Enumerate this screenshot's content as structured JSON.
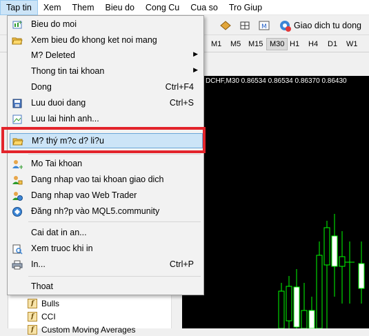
{
  "menubar": {
    "items": [
      "Tap tin",
      "Xem",
      "Them",
      "Bieu do",
      "Cong Cu",
      "Cua so",
      "Tro Giup"
    ]
  },
  "toolbar": {
    "trading_label": "Giao dich tu dong"
  },
  "timeframes": [
    "M1",
    "M5",
    "M15",
    "M30",
    "H1",
    "H4",
    "D1",
    "W1"
  ],
  "timeframe_active": "M30",
  "chart": {
    "header": "DCHF,M30  0.86534 0.86534 0.86370 0.86430"
  },
  "navigator": {
    "items": [
      "Bulls",
      "CCI",
      "Custom Moving Averages"
    ]
  },
  "file_menu": {
    "items": [
      {
        "label": "Bieu do moi",
        "shortcut": "",
        "icon": "new-chart-icon"
      },
      {
        "label": "Xem bieu đo khong ket noi mang",
        "shortcut": "",
        "icon": "open-folder-icon"
      },
      {
        "label": "M? Deleted",
        "shortcut": "",
        "icon": "",
        "submenu": true
      },
      {
        "label": "Thong tin tai khoan",
        "shortcut": "",
        "icon": "",
        "submenu": true
      },
      {
        "label": "Dong",
        "shortcut": "Ctrl+F4",
        "icon": ""
      },
      {
        "label": "Luu duoi dang",
        "shortcut": "Ctrl+S",
        "icon": "save-icon"
      },
      {
        "label": "Luu lai hinh anh...",
        "shortcut": "",
        "icon": "save-image-icon"
      },
      {
        "label": "M? thý m?c d? li?u",
        "shortcut": "",
        "icon": "data-folder-icon"
      },
      {
        "label": "Mo Tai khoan",
        "shortcut": "",
        "icon": "add-account-icon"
      },
      {
        "label": "Dang nhap vao tai khoan giao dich",
        "shortcut": "",
        "icon": "login-icon"
      },
      {
        "label": "Dang nhap vao Web Trader",
        "shortcut": "",
        "icon": "web-login-icon"
      },
      {
        "label": "Đăng nh?p vào MQL5.community",
        "shortcut": "",
        "icon": "mql5-icon"
      },
      {
        "label": "Cai dat in an...",
        "shortcut": "",
        "icon": ""
      },
      {
        "label": "Xem truoc khi in",
        "shortcut": "",
        "icon": "print-preview-icon"
      },
      {
        "label": "In...",
        "shortcut": "Ctrl+P",
        "icon": "print-icon"
      },
      {
        "label": "Thoat",
        "shortcut": "",
        "icon": ""
      }
    ]
  },
  "colors": {
    "highlight": "#cce4f7",
    "red_box": "#e3242b",
    "bull_candle": "#00ff00",
    "chart_bg": "#000000"
  }
}
